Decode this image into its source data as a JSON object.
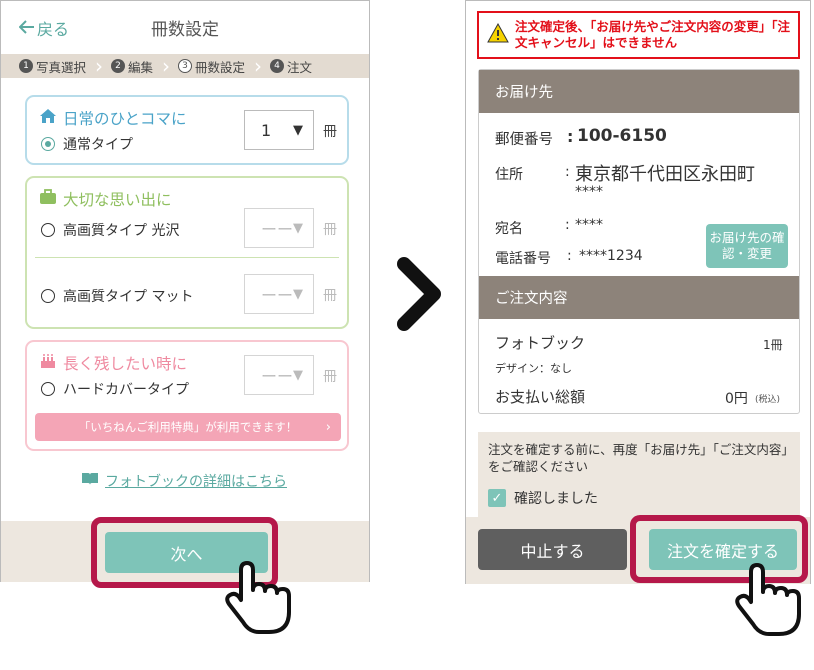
{
  "left": {
    "back_label": "戻る",
    "title": "冊数設定",
    "steps": [
      {
        "num": "1",
        "label": "写真選択"
      },
      {
        "num": "2",
        "label": "編集"
      },
      {
        "num": "3",
        "label": "冊数設定"
      },
      {
        "num": "4",
        "label": "注文"
      }
    ],
    "card1": {
      "title": "日常のひとコマに",
      "option": "通常タイプ",
      "qty": "1",
      "unit": "冊"
    },
    "card2": {
      "title": "大切な思い出に",
      "option1": "高画質タイプ 光沢",
      "option2": "高画質タイプ マット",
      "qty_placeholder": "ーー",
      "unit": "冊"
    },
    "card3": {
      "title": "長く残したい時に",
      "option": "ハードカバータイプ",
      "qty_placeholder": "ーー",
      "unit": "冊",
      "benefit": "「いちねんご利用特典」が利用できます！"
    },
    "detail_link": "フォトブックの詳細はこちら",
    "next_label": "次へ"
  },
  "right": {
    "warning": "注文確定後、「お届け先やご注文内容の変更」「注文キャンセル」はできません",
    "delivery_header": "お届け先",
    "postal_label": "郵便番号",
    "postal_value": "100-6150",
    "address_label": "住所",
    "address_value": "東京都千代田区永田町",
    "address_value2": "****",
    "name_label": "宛名",
    "name_value": "****",
    "phone_label": "電話番号",
    "phone_value": "****1234",
    "edit_label": "お届け先の確認・変更",
    "order_header": "ご注文内容",
    "product": "フォトブック",
    "product_qty": "1冊",
    "design": "デザイン：なし",
    "total_label": "お支払い総額",
    "total_value": "0円",
    "tax_note": "(税込)",
    "confirm_text": "注文を確定する前に、再度「お届け先」「ご注文内容」をご確認ください",
    "confirm_check": "確認しました",
    "cancel_label": "中止する",
    "confirm_label": "注文を確定する"
  },
  "colors": {
    "accent": "#7ec4b8",
    "highlight": "#b5184a",
    "warning": "#e3101a",
    "section_header": "#8d837a"
  }
}
